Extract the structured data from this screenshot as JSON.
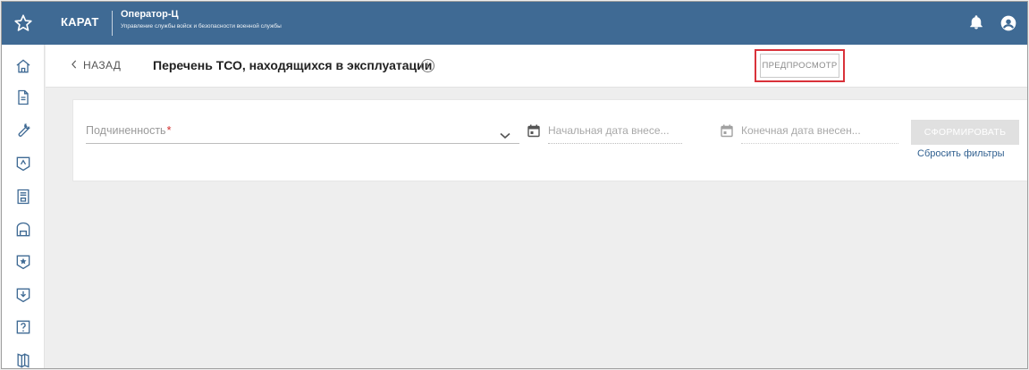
{
  "topbar": {
    "brand": "КАРАТ",
    "app_title": "Оператор-Ц",
    "app_subtitle": "Управление службы войск и безопасности военной службы"
  },
  "sidebar": {
    "items": [
      {
        "icon": "home-icon"
      },
      {
        "icon": "document-icon"
      },
      {
        "icon": "wrench-icon"
      },
      {
        "icon": "shield-arrow-icon"
      },
      {
        "icon": "report-icon"
      },
      {
        "icon": "archive-icon"
      },
      {
        "icon": "star-badge-icon"
      },
      {
        "icon": "download-icon"
      },
      {
        "icon": "help-icon"
      },
      {
        "icon": "book-icon"
      }
    ]
  },
  "header": {
    "back_label": "НАЗАД",
    "title": "Перечень ТСО, находящихся в эксплуатации",
    "info_glyph": "i",
    "preview_label": "ПРЕДПРОСМОТР"
  },
  "filters": {
    "subordination_placeholder": "Подчиненность",
    "required_mark": "*",
    "start_date_placeholder": "Начальная дата внесе...",
    "end_date_placeholder": "Конечная дата внесен...",
    "form_button": "СФОРМИРОВАТЬ",
    "reset_link": "Сбросить фильтры"
  },
  "colors": {
    "topbar": "#3f6a94",
    "accent_link": "#2f5f8f",
    "highlight": "#d9323a"
  }
}
